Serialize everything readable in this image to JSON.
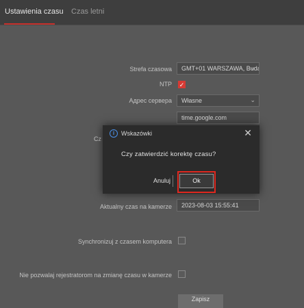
{
  "tabs": [
    {
      "label": "Ustawienia czasu",
      "active": true
    },
    {
      "label": "Czas letni",
      "active": false
    }
  ],
  "form": {
    "timezone_label": "Strefa czasowa",
    "timezone_value": "GMT+01 WARSZAWA, Buda",
    "ntp_label": "NTP",
    "ntp_checked": true,
    "server_address_label": "Адрес сервера",
    "server_address_value": "Własne",
    "ntp_server_value": "time.google.com",
    "partial_label_behind_dialog": "Cz",
    "camera_time_label": "Aktualny czas na kamerze",
    "camera_time_value": "2023-08-03 15:55:41",
    "sync_pc_label": "Synchronizuj z czasem komputera",
    "sync_pc_checked": false,
    "block_nvr_label": "Nie pozwalaj rejestratorom na zmianę czasu w kamerze",
    "block_nvr_checked": false,
    "save_button": "Zapisz"
  },
  "dialog": {
    "title": "Wskazówki",
    "message": "Czy zatwierdzić korektę czasu?",
    "cancel": "Anuluj",
    "ok": "Ok",
    "close_symbol": "✕",
    "info_symbol": "i"
  },
  "colors": {
    "accent": "#d63a34",
    "highlight": "#e0281f",
    "info_icon": "#4a8fe7",
    "background": "#585858"
  }
}
